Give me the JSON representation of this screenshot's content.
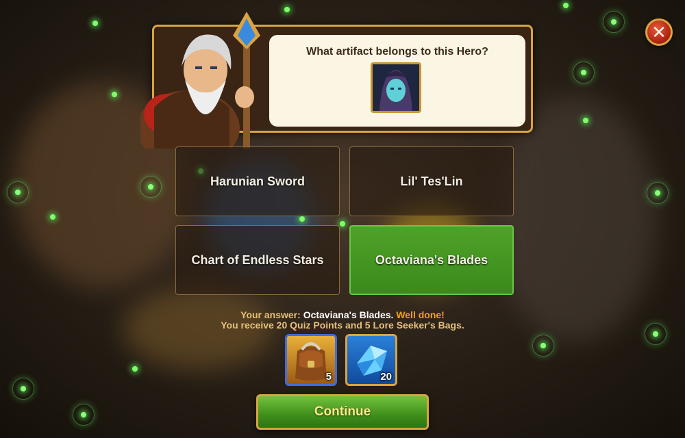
{
  "quiz": {
    "question": "What artifact belongs to this Hero?",
    "options": [
      {
        "label": "Harunian Sword",
        "state": "default"
      },
      {
        "label": "Lil' Tes'Lin",
        "state": "default"
      },
      {
        "label": "Chart of Endless Stars",
        "state": "default"
      },
      {
        "label": "Octaviana's Blades",
        "state": "correct"
      }
    ]
  },
  "result": {
    "answer_prefix": "Your answer:",
    "answer_value": "Octaviana's Blades.",
    "verdict": "Well done!",
    "reward_text": "You receive 20 Quiz Points and 5 Lore Seeker's Bags."
  },
  "rewards": [
    {
      "icon": "lore-seekers-bag-icon",
      "count": "5"
    },
    {
      "icon": "quiz-points-crystal-icon",
      "count": "20"
    }
  ],
  "buttons": {
    "continue": "Continue",
    "close": "close-icon"
  },
  "colors": {
    "correct": "#3f9a20",
    "frame_gold": "#d9a441",
    "highlight": "#f0a21a"
  }
}
